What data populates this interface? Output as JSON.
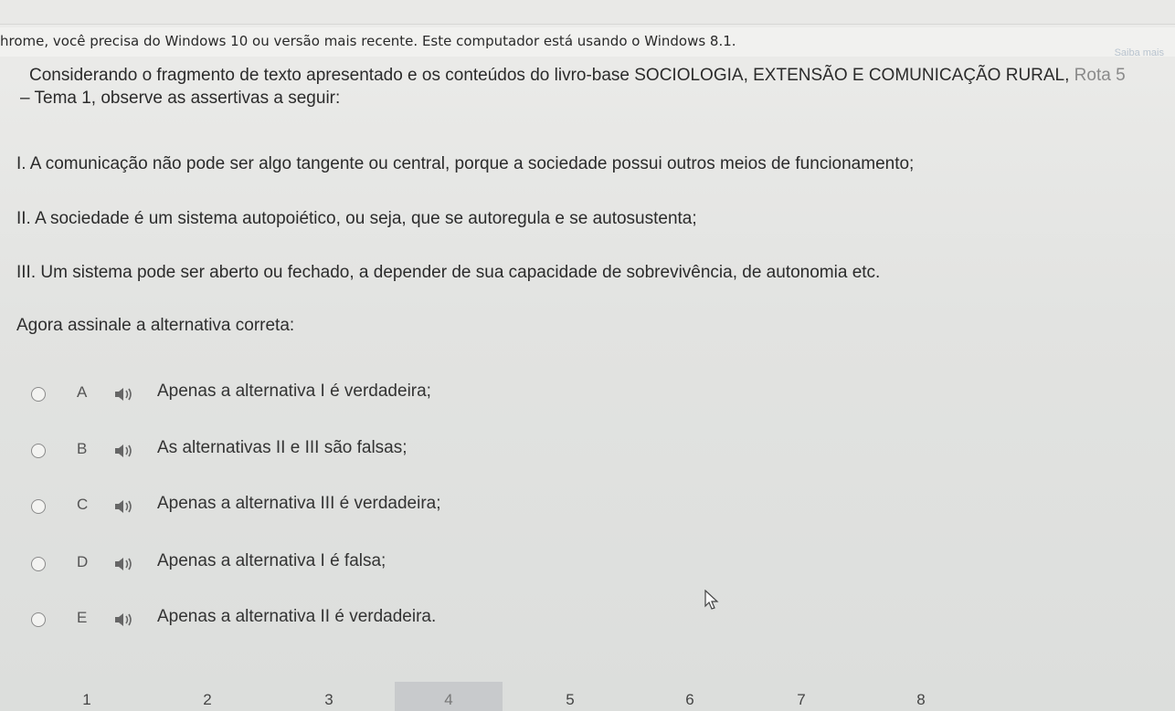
{
  "banner": {
    "text": "hrome, você precisa do Windows 10 ou versão mais recente. Este computador está usando o Windows 8.1.",
    "learn_more": "Saiba mais"
  },
  "question": {
    "line1": "Considerando o fragmento de texto apresentado e os conteúdos do livro-base SOCIOLOGIA, EXTENSÃO E COMUNICAÇÃO RURAL,",
    "line1_tail": " Rota 5",
    "line2": "– Tema 1, observe as assertivas a seguir:"
  },
  "assertions": [
    "I. A comunicação não pode ser algo tangente ou central, porque a sociedade possui outros meios de funcionamento;",
    "II. A sociedade é um sistema autopoiético, ou seja, que se autoregula e se autosustenta;",
    "III. Um sistema pode ser aberto ou fechado, a depender de sua capacidade de sobrevivência, de autonomia etc."
  ],
  "prompt": "Agora assinale a alternativa correta:",
  "options": [
    {
      "letter": "A",
      "text": "Apenas a alternativa I é verdadeira;"
    },
    {
      "letter": "B",
      "text": "As alternativas II e III são falsas;"
    },
    {
      "letter": "C",
      "text": "Apenas a alternativa III é verdadeira;"
    },
    {
      "letter": "D",
      "text": "Apenas a alternativa I é falsa;"
    },
    {
      "letter": "E",
      "text": "Apenas a alternativa II é verdadeira."
    }
  ],
  "pagination": {
    "pages": [
      "1",
      "2",
      "3",
      "4",
      "5",
      "6",
      "7",
      "8"
    ],
    "active": "4"
  },
  "icons": {
    "option_audio": "speaker-icon",
    "pointer": "mouse-cursor-icon"
  }
}
